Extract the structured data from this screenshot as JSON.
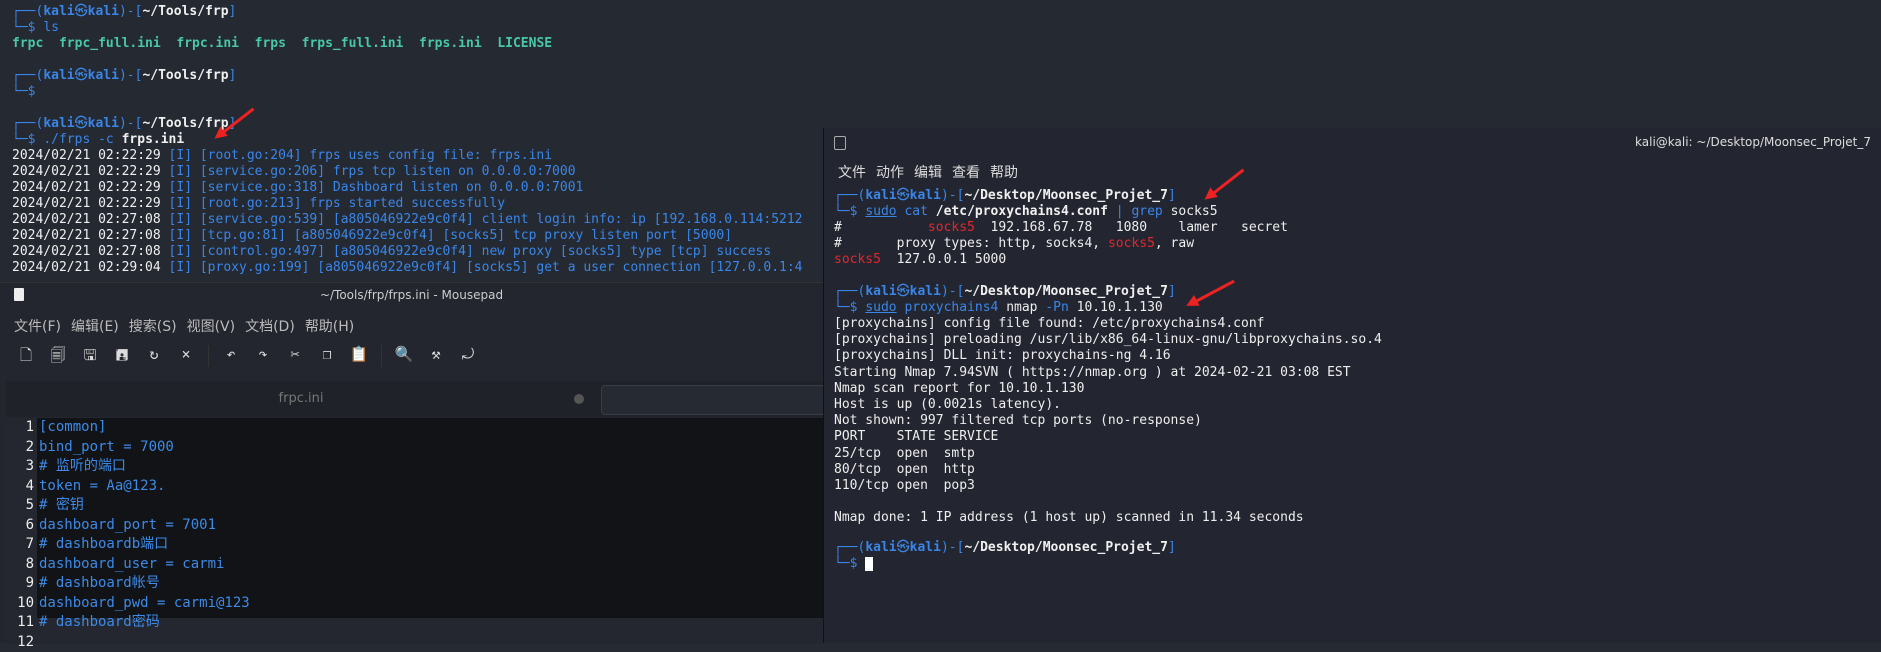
{
  "top_terminal": {
    "prompt_user": "kali",
    "prompt_host": "kali",
    "prompt_path": "~/Tools/frp",
    "cmd1": "ls",
    "files": [
      "frpc",
      "frpc_full.ini",
      "frpc.ini",
      "frps",
      "frps_full.ini",
      "frps.ini",
      "LICENSE"
    ],
    "cmd3_prog": "./frps -c",
    "cmd3_arg": "frps.ini",
    "logs": [
      {
        "ts": "2024/02/21 02:22:29",
        "msg": "[I] [root.go:204] frps uses config file: frps.ini"
      },
      {
        "ts": "2024/02/21 02:22:29",
        "msg": "[I] [service.go:206] frps tcp listen on 0.0.0.0:7000"
      },
      {
        "ts": "2024/02/21 02:22:29",
        "msg": "[I] [service.go:318] Dashboard listen on 0.0.0.0:7001"
      },
      {
        "ts": "2024/02/21 02:22:29",
        "msg": "[I] [root.go:213] frps started successfully"
      },
      {
        "ts": "2024/02/21 02:27:08",
        "msg": "[I] [service.go:539] [a805046922e9c0f4] client login info: ip [192.168.0.114:5212"
      },
      {
        "ts": "2024/02/21 02:27:08",
        "msg": "[I] [tcp.go:81] [a805046922e9c0f4] [socks5] tcp proxy listen port [5000]"
      },
      {
        "ts": "2024/02/21 02:27:08",
        "msg": "[I] [control.go:497] [a805046922e9c0f4] new proxy [socks5] type [tcp] success"
      },
      {
        "ts": "2024/02/21 02:29:04",
        "msg": "[I] [proxy.go:199] [a805046922e9c0f4] [socks5] get a user connection [127.0.0.1:4"
      }
    ]
  },
  "mousepad": {
    "title": "~/Tools/frp/frps.ini - Mousepad",
    "menu": [
      "文件(F)",
      "编辑(E)",
      "搜索(S)",
      "视图(V)",
      "文档(D)",
      "帮助(H)"
    ],
    "tab_label": "frpc.ini",
    "lines": [
      "[common]",
      "bind_port = 7000",
      "# 监听的端口",
      "token = Aa@123.",
      "# 密钥",
      "dashboard_port = 7001",
      "# dashboardb端口",
      "dashboard_user = carmi",
      "# dashboard帐号",
      "dashboard_pwd = carmi@123",
      "# dashboard密码",
      ""
    ]
  },
  "right_terminal": {
    "title": "kali@kali: ~/Desktop/Moonsec_Projet_7",
    "menu": [
      "文件",
      "动作",
      "编辑",
      "查看",
      "帮助"
    ],
    "prompt_path": "~/Desktop/Moonsec_Projet_7",
    "cmd1": {
      "sudo": "sudo",
      "cat": "cat",
      "file": "/etc/proxychains4.conf",
      "pipe": "|",
      "grep": "grep",
      "arg": "socks5"
    },
    "grep_out": [
      {
        "pre": "#           ",
        "hl": "socks5",
        "post": "  192.168.67.78   1080    lamer   secret"
      },
      {
        "pre": "#       proxy types: http, socks4, ",
        "hl": "socks5",
        "post": ", raw"
      },
      {
        "pre": "",
        "hl": "socks5",
        "post": "  127.0.0.1 5000"
      }
    ],
    "cmd2": {
      "sudo": "sudo",
      "prog": "proxychains4",
      "cmd": "nmap",
      "flag": "-Pn",
      "target": "10.10.1.130"
    },
    "output": [
      "[proxychains] config file found: /etc/proxychains4.conf",
      "[proxychains] preloading /usr/lib/x86_64-linux-gnu/libproxychains.so.4",
      "[proxychains] DLL init: proxychains-ng 4.16",
      "Starting Nmap 7.94SVN ( https://nmap.org ) at 2024-02-21 03:08 EST",
      "Nmap scan report for 10.10.1.130",
      "Host is up (0.0021s latency).",
      "Not shown: 997 filtered tcp ports (no-response)",
      "PORT    STATE SERVICE",
      "25/tcp  open  smtp",
      "80/tcp  open  http",
      "110/tcp open  pop3",
      "",
      "Nmap done: 1 IP address (1 host up) scanned in 11.34 seconds"
    ]
  },
  "colors": {
    "accent_blue": "#3a86e8",
    "highlight_red": "#e3262d",
    "file_green": "#48c8a8",
    "annotation_arrow": "#ee2222"
  }
}
